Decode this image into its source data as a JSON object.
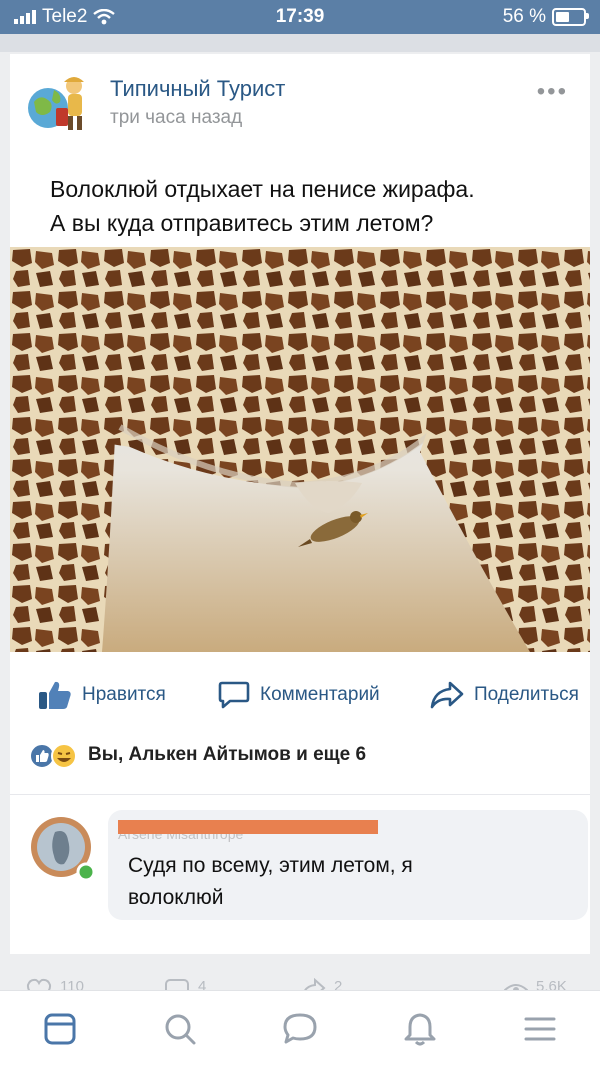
{
  "status_bar": {
    "carrier": "Tele2",
    "time": "17:39",
    "battery": "56 %",
    "battery_level": 0.56
  },
  "post": {
    "author": "Типичный Турист",
    "time": "три часа назад",
    "text_line1": "Волоклюй отдыхает на пенисе жирафа.",
    "text_line2": "А вы куда отправитесь этим летом?"
  },
  "actions": {
    "like": "Нравится",
    "comment": "Комментарий",
    "share": "Поделиться"
  },
  "reactions": {
    "text": "Вы, Алькен Айтымов и еще 6"
  },
  "comment": {
    "author": "Arsene Misanthrope",
    "text": "Судя по всему, этим летом, я волоклюй"
  },
  "stats": {
    "likes": "110",
    "comments": "4",
    "shares": "2",
    "views": "5,6K"
  },
  "colors": {
    "accent": "#2a5885",
    "status_bar": "#5b7fa6",
    "redaction": "#e8804f",
    "online": "#4bb34b"
  },
  "icons": [
    "wifi-icon",
    "more-icon",
    "like-icon",
    "comment-icon",
    "share-icon",
    "news-icon",
    "search-icon",
    "messages-icon",
    "notifications-icon",
    "menu-icon"
  ]
}
